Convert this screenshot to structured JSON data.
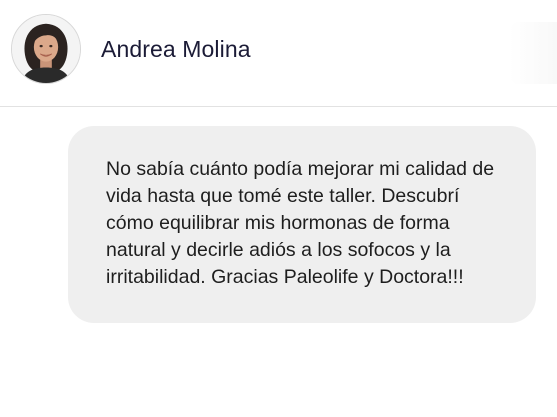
{
  "header": {
    "contact_name": "Andrea Molina",
    "avatar_icon": "person-avatar-icon"
  },
  "message": {
    "text": "No sabía cuánto podía mejorar mi calidad de vida hasta que tomé este taller. Descubrí cómo equilibrar mis hormonas de forma natural y decirle adiós a los sofocos y la irritabilidad. Gracias Paleolife y Doctora!!!"
  },
  "colors": {
    "bubble_background": "#efefef",
    "name_text": "#1b1b36",
    "divider": "#e2e2e2"
  }
}
